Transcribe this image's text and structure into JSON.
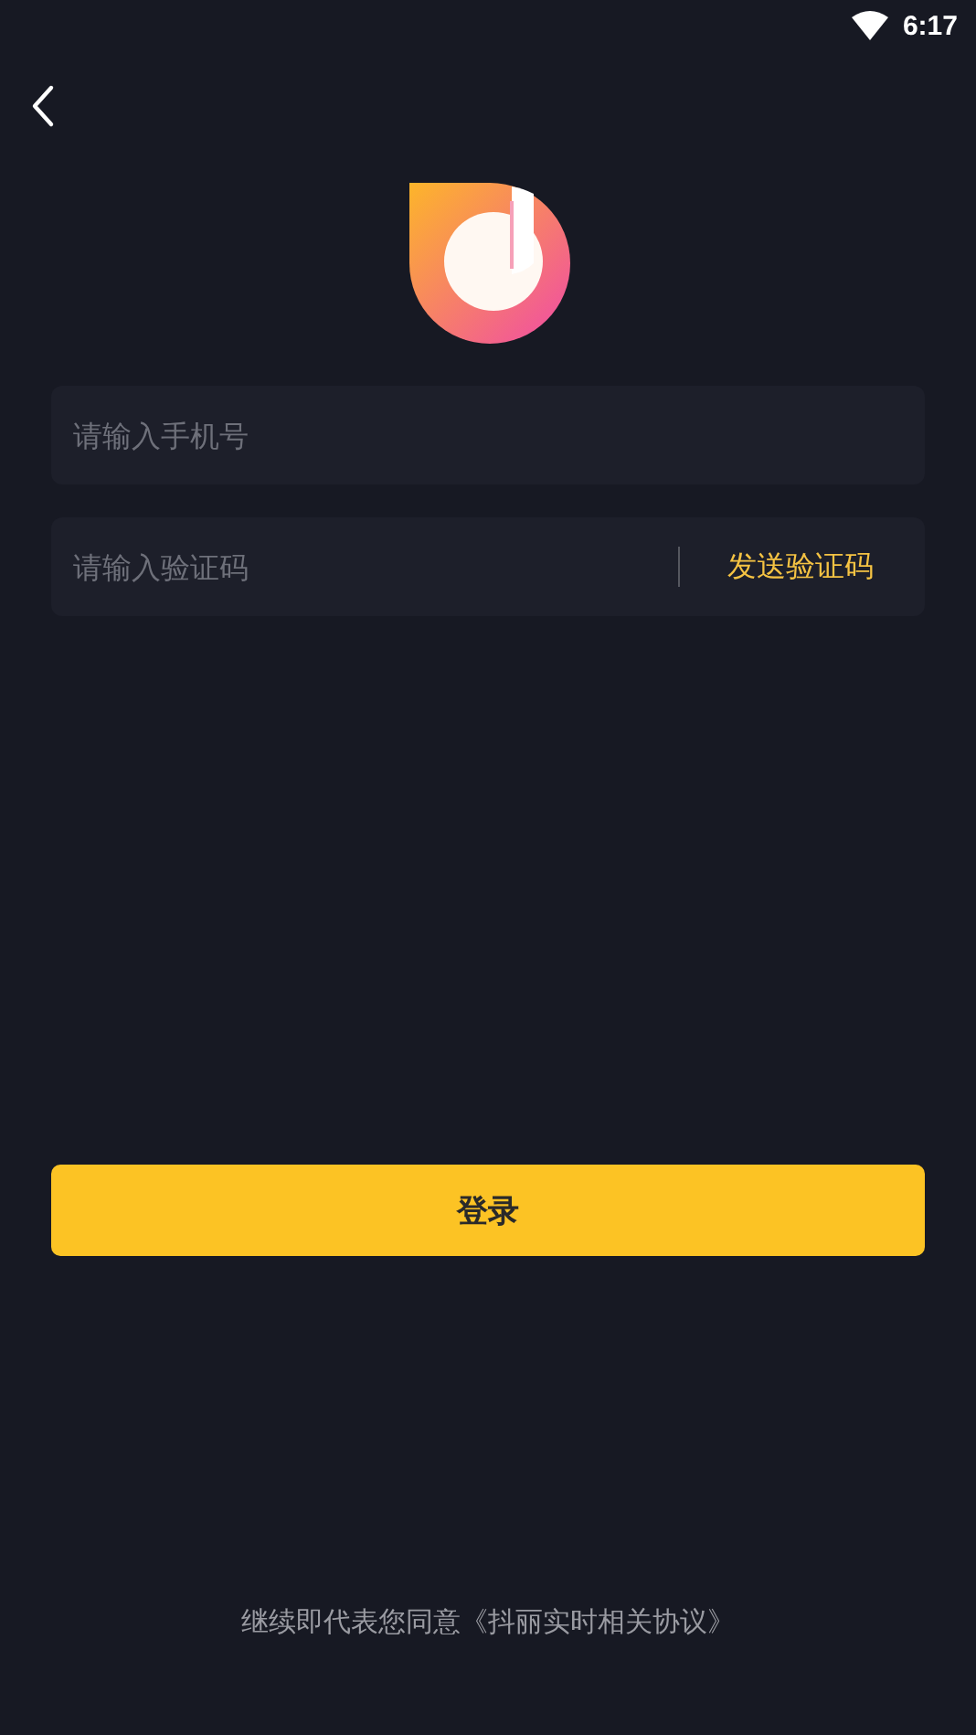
{
  "status_bar": {
    "time": "6:17"
  },
  "phone_field": {
    "placeholder": "请输入手机号"
  },
  "code_field": {
    "placeholder": "请输入验证码"
  },
  "send_code_button": {
    "label": "发送验证码"
  },
  "login_button": {
    "label": "登录"
  },
  "agreement": {
    "text": "继续即代表您同意《抖丽实时相关协议》"
  }
}
